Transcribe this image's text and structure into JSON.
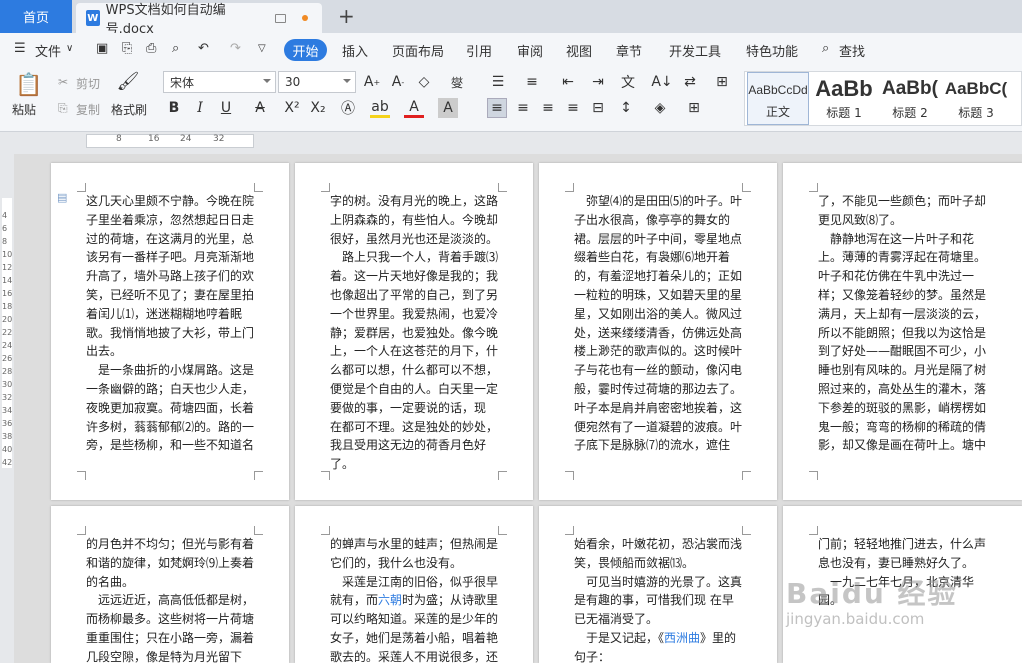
{
  "title_bar": {
    "home_tab": "首页",
    "doc_tab": "WPS文档如何自动编号.docx",
    "doc_icon": "W",
    "new_tab": "+"
  },
  "menu": {
    "file": "文件",
    "start": "开始",
    "items": [
      "插入",
      "页面布局",
      "引用",
      "审阅",
      "视图",
      "章节",
      "开发工具",
      "特色功能"
    ],
    "search": "查找"
  },
  "ribbon": {
    "paste": "粘贴",
    "cut": "剪切",
    "copy": "复制",
    "format_painter": "格式刷",
    "font_name": "宋体",
    "font_size": "30",
    "pinyin": "燮",
    "styles": [
      {
        "preview": "AaBbCcDd",
        "label": "正文"
      },
      {
        "preview": "AaBb",
        "label": "标题 1"
      },
      {
        "preview": "AaBb(",
        "label": "标题 2"
      },
      {
        "preview": "AaBbC(",
        "label": "标题 3"
      }
    ]
  },
  "ruler": {
    "h": [
      "8",
      "16",
      "24",
      "32"
    ],
    "v": [
      "4",
      "6",
      "8",
      "10",
      "12",
      "14",
      "16",
      "18",
      "20",
      "22",
      "24",
      "26",
      "28",
      "30",
      "32",
      "34",
      "36",
      "38",
      "40",
      "42",
      "44"
    ]
  },
  "pages": {
    "p1": "这几天心里颇不宁静。今晚在院子里坐着乘凉，忽然想起日日走过的荷塘，在这满月的光里，总该另有一番样子吧。月亮渐渐地升高了，墙外马路上孩子们的欢笑，已经听不见了；妻在屋里拍着闰儿⑴，迷迷糊糊地哼着眠歌。我悄悄地披了大衫，带上门出去。\n　是一条曲折的小煤屑路。这是一条幽僻的路；白天也少人走，夜晚更加寂寞。荷塘四面，长着许多树，蓊蓊郁郁⑵的。路的一旁，是些杨柳，和一些不知道名",
    "p2": "字的树。没有月光的晚上，这路上阴森森的，有些怕人。今晚却很好，虽然月光也还是淡淡的。\n　路上只我一个人，背着手踱⑶着。这一片天地好像是我的；我也像超出了平常的自己，到了另一个世界里。我爱热闹，也爱冷静；爱群居，也爱独处。像今晚上，一个人在这苍茫的月下，什么都可以想，什么都可以不想，便觉是个自由的人。白天里一定要做的事，一定要说的话，现 在都可不理。这是独处的妙处，我且受用这无边的荷香月色好了。",
    "p3": "　弥望⑷的是田田⑸的叶子。叶子出水很高，像亭亭的舞女的裙。层层的叶子中间，零星地点缀着些白花，有袅娜⑹地开着的，有羞涩地打着朵儿的；正如一粒粒的明珠，又如碧天里的星星，又如刚出浴的美人。微风过处，送来缕缕清香，仿佛远处高楼上渺茫的歌声似的。这时候叶子与花也有一丝的颤动，像闪电般，霎时传过荷塘的那边去了。叶子本是肩并肩密密地挨着，这便宛然有了一道凝碧的波痕。叶子底下是脉脉⑺的流水，遮住",
    "p4": "了，不能见一些颜色；而叶子却更见风致⑻了。\n　静静地泻在这一片叶子和花上。薄薄的青雾浮起在荷塘里。叶子和花仿佛在牛乳中洗过一样；又像笼着轻纱的梦。虽然是满月，天上却有一层淡淡的云，所以不能朗照；但我以为这恰是到了好处——酣眠固不可少，小睡也别有风味的。月光是隔了树照过来的，高处丛生的灌木，落下参差的斑驳的黑影，峭楞楞如鬼一般；弯弯的杨柳的稀疏的倩影，却又像是画在荷叶上。塘中",
    "p5": "的月色并不均匀；但光与影有着和谐的旋律，如梵婀玲⑼上奏着的名曲。\n　远远近近，高高低低都是树，而杨柳最多。这些树将一片荷塘重重围住；只在小路一旁，漏着几段空隙，像是特为月光留下",
    "p6a": "的蝉声与水里的蛙声；但热闹是它们的，我什么也没有。\n　采莲是江南的旧俗，似乎很早就有，而",
    "p6link": "六朝",
    "p6b": "时为盛；从诗歌里可以约略知道。采莲的是少年的女子，她们是荡着小船，唱着艳歌去的。采莲人不用说很多，还",
    "p7a": "始看余，叶嫩花初，恐沾裳而浅笑，畏倾船而敛裾⒀。\n　可见当时嬉游的光景了。这真是有趣的事，可惜我们现 在早已无福消受了。\n　于是又记起，《",
    "p7link": "西洲曲",
    "p7b": "》里的句子：",
    "p8": "门前；轻轻地推门进去，什么声息也没有，妻已睡熟好久了。\n　一九二七年七月，北京清华园。"
  },
  "watermark": {
    "main": "Baidu 经验",
    "sub": "jingyan.baidu.com"
  }
}
